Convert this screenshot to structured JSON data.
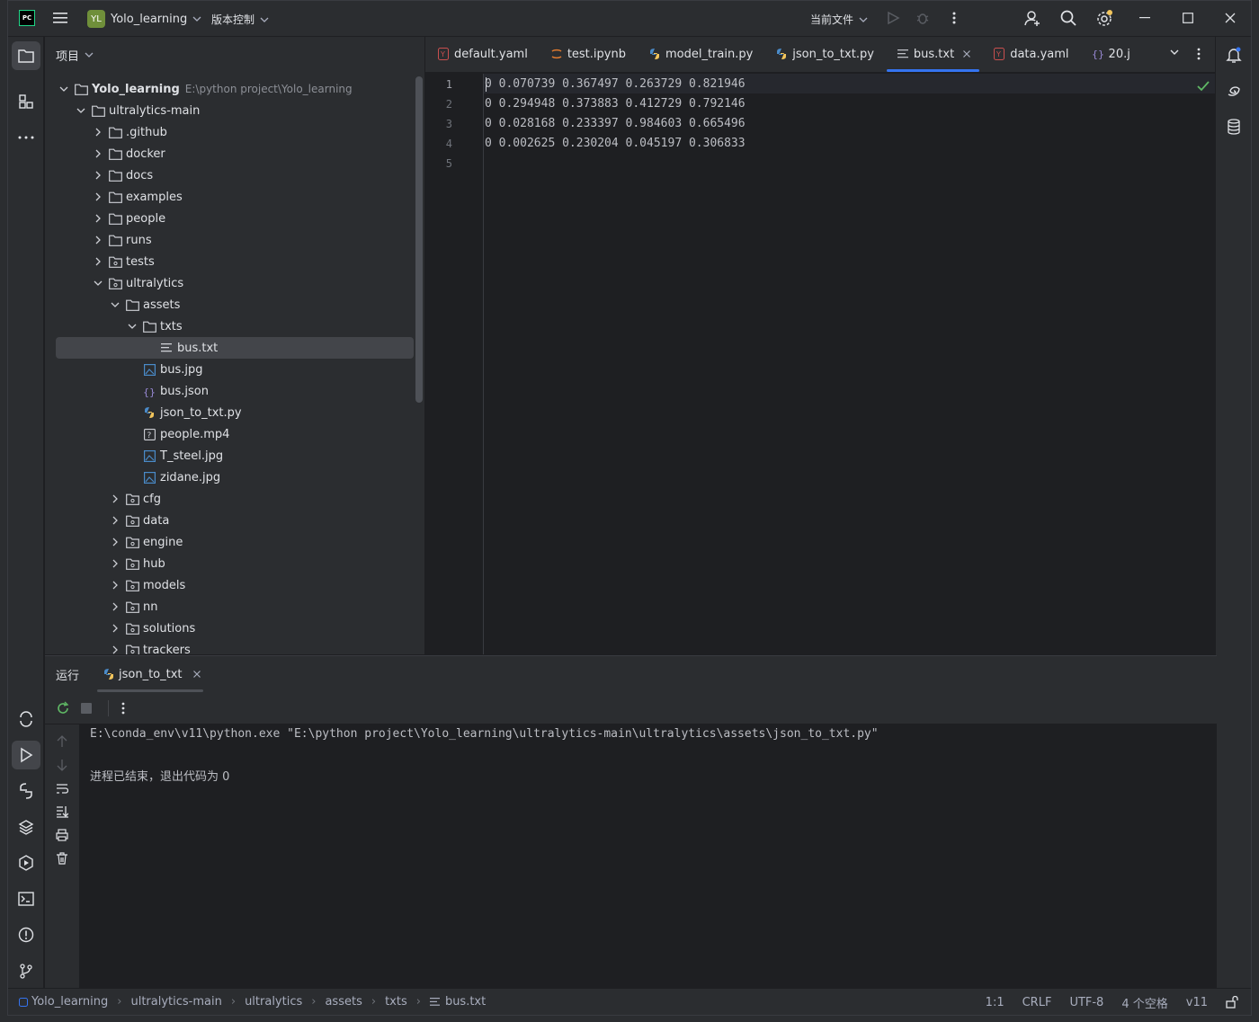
{
  "titlebar": {
    "app_logo": "PC",
    "project_badge": "YL",
    "project_name": "Yolo_learning",
    "vcs_label": "版本控制",
    "run_config": "当前文件"
  },
  "project_panel": {
    "title": "项目",
    "root": {
      "name": "Yolo_learning",
      "path": "E:\\python project\\Yolo_learning"
    },
    "items": [
      {
        "label": "ultralytics-main"
      },
      {
        "label": ".github"
      },
      {
        "label": "docker"
      },
      {
        "label": "docs"
      },
      {
        "label": "examples"
      },
      {
        "label": "people"
      },
      {
        "label": "runs"
      },
      {
        "label": "tests"
      },
      {
        "label": "ultralytics"
      },
      {
        "label": "assets"
      },
      {
        "label": "txts"
      },
      {
        "label": "bus.txt"
      },
      {
        "label": "bus.jpg"
      },
      {
        "label": "bus.json"
      },
      {
        "label": "json_to_txt.py"
      },
      {
        "label": "people.mp4"
      },
      {
        "label": "T_steel.jpg"
      },
      {
        "label": "zidane.jpg"
      },
      {
        "label": "cfg"
      },
      {
        "label": "data"
      },
      {
        "label": "engine"
      },
      {
        "label": "hub"
      },
      {
        "label": "models"
      },
      {
        "label": "nn"
      },
      {
        "label": "solutions"
      },
      {
        "label": "trackers"
      }
    ]
  },
  "editor": {
    "tabs": [
      {
        "label": "default.yaml"
      },
      {
        "label": "test.ipynb"
      },
      {
        "label": "model_train.py"
      },
      {
        "label": "json_to_txt.py"
      },
      {
        "label": "bus.txt"
      },
      {
        "label": "data.yaml"
      },
      {
        "label": "20.j"
      }
    ],
    "line_numbers": [
      "1",
      "2",
      "3",
      "4",
      "5"
    ],
    "lines": [
      "0 0.070739 0.367497 0.263729 0.821946",
      "0 0.294948 0.373883 0.412729 0.792146",
      "0 0.028168 0.233397 0.984603 0.665496",
      "0 0.002625 0.230204 0.045197 0.306833",
      ""
    ]
  },
  "run_panel": {
    "title": "运行",
    "tab_label": "json_to_txt",
    "console_lines": [
      "E:\\conda_env\\v11\\python.exe \"E:\\python project\\Yolo_learning\\ultralytics-main\\ultralytics\\assets\\json_to_txt.py\"",
      "",
      "进程已结束，退出代码为 0"
    ]
  },
  "statusbar": {
    "breadcrumbs": [
      "Yolo_learning",
      "ultralytics-main",
      "ultralytics",
      "assets",
      "txts",
      "bus.txt"
    ],
    "position": "1:1",
    "line_ending": "CRLF",
    "encoding": "UTF-8",
    "indent": "4 个空格",
    "interpreter": "v11"
  },
  "colors": {
    "accent": "#3574f0",
    "success": "#5fb865",
    "yaml": "#c94f4f",
    "python": "#4a8bc9"
  }
}
